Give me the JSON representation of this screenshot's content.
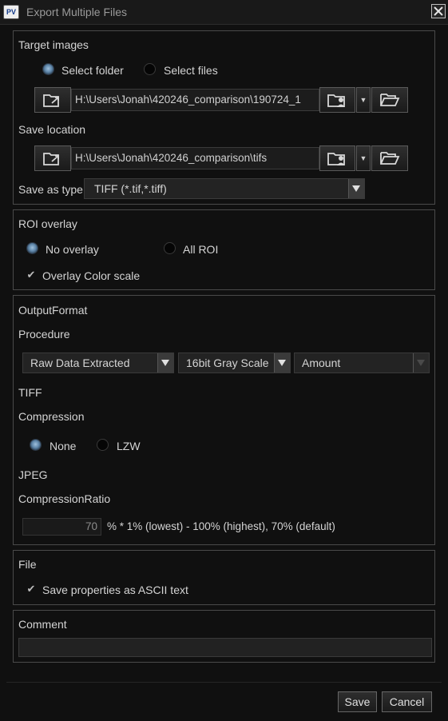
{
  "window": {
    "app_badge": "PV",
    "title": "Export Multiple Files"
  },
  "target": {
    "heading": "Target images",
    "radio_folder": "Select folder",
    "radio_files": "Select files",
    "selected": "folder",
    "path": "H:\\Users\\Jonah\\420246_comparison\\190724_1"
  },
  "save": {
    "heading": "Save location",
    "path": "H:\\Users\\Jonah\\420246_comparison\\tifs",
    "type_label": "Save as type:",
    "type_value": "TIFF (*.tif,*.tiff)"
  },
  "roi": {
    "heading": "ROI overlay",
    "no_overlay": "No overlay",
    "all_roi": "All ROI",
    "selected": "no_overlay",
    "color_scale": "Overlay Color scale",
    "color_scale_checked": true
  },
  "output": {
    "heading": "OutputFormat",
    "procedure_label": "Procedure",
    "procedure_value": "Raw Data Extracted",
    "depth_value": "16bit Gray Scale",
    "amount_value": "Amount",
    "tiff_label": "TIFF",
    "compression_label": "Compression",
    "comp_none": "None",
    "comp_lzw": "LZW",
    "comp_selected": "none",
    "jpeg_label": "JPEG",
    "ratio_label": "CompressionRatio",
    "ratio_value": "70",
    "ratio_hint": "% * 1% (lowest) - 100% (highest), 70% (default)"
  },
  "file": {
    "heading": "File",
    "ascii_label": "Save properties as ASCII text",
    "ascii_checked": true
  },
  "comment": {
    "heading": "Comment",
    "value": ""
  },
  "footer": {
    "save_label": "Save",
    "cancel_label": "Cancel"
  }
}
